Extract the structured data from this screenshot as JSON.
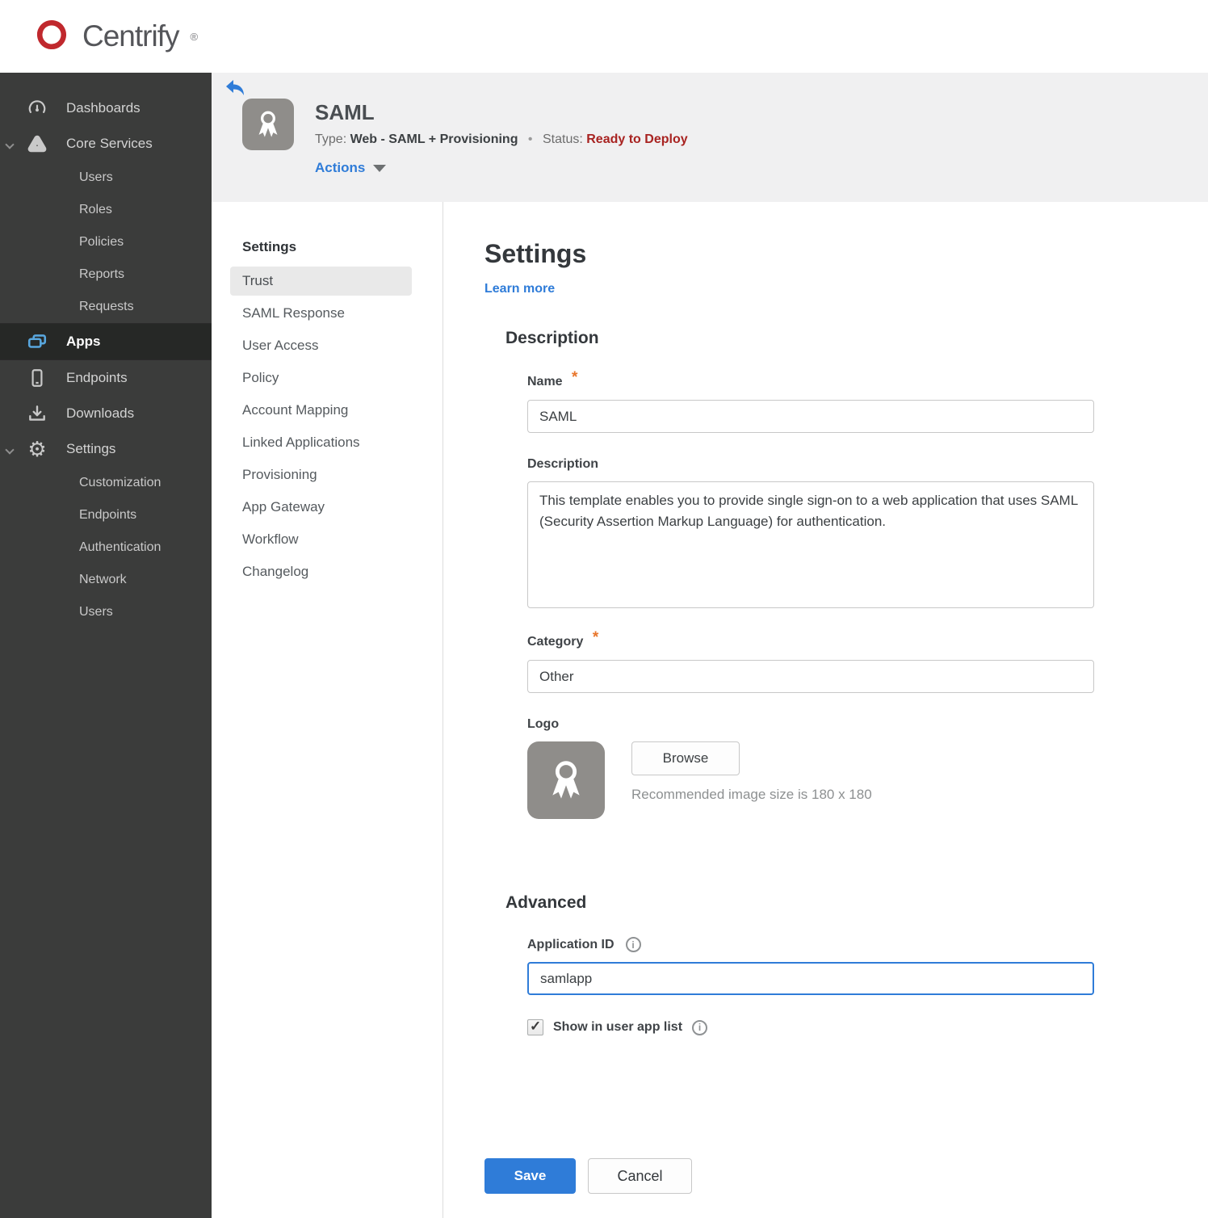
{
  "brand": {
    "name": "Centrify",
    "registered": "®",
    "logo_color": "#c0282d",
    "text_color": "#55565a"
  },
  "sidebar": {
    "dashboards": "Dashboards",
    "core_services": "Core Services",
    "core_children": [
      "Users",
      "Roles",
      "Policies",
      "Reports",
      "Requests"
    ],
    "apps": "Apps",
    "endpoints": "Endpoints",
    "downloads": "Downloads",
    "settings": "Settings",
    "settings_children": [
      "Customization",
      "Endpoints",
      "Authentication",
      "Network",
      "Users"
    ],
    "active_item": "Apps",
    "bg_color": "#3b3c3b",
    "active_icon_color": "#58a6dd"
  },
  "app_header": {
    "title": "SAML",
    "type_label": "Type:",
    "type_value": "Web - SAML + Provisioning",
    "separator": "•",
    "status_label": "Status:",
    "status_value": "Ready to Deploy",
    "status_color": "#a82321",
    "actions_label": "Actions"
  },
  "app_nav": {
    "header": "Settings",
    "items": [
      "Trust",
      "SAML Response",
      "User Access",
      "Policy",
      "Account Mapping",
      "Linked Applications",
      "Provisioning",
      "App Gateway",
      "Workflow",
      "Changelog"
    ],
    "selected": "Trust"
  },
  "main": {
    "title": "Settings",
    "learn_more": "Learn more",
    "description": {
      "heading": "Description",
      "name_label": "Name",
      "required_mark": "*",
      "name_value": "SAML",
      "description_label": "Description",
      "description_value": "This template enables you to provide single sign-on to a web application that uses SAML (Security Assertion Markup Language) for authentication.",
      "category_label": "Category",
      "category_value": "Other",
      "logo_label": "Logo",
      "browse_button": "Browse",
      "logo_hint": "Recommended image size is 180 x 180"
    },
    "advanced": {
      "heading": "Advanced",
      "app_id_label": "Application ID",
      "app_id_value": "samlapp",
      "show_in_list_label": "Show in user app list",
      "checked_attr": "checked"
    },
    "buttons": {
      "save": "Save",
      "cancel": "Cancel"
    }
  },
  "colors": {
    "accent_blue": "#2f7cd8",
    "status_red": "#a82321",
    "required_orange": "#e8762c",
    "brand_red": "#c0282d",
    "app_icon_gray": "#8f8d8a"
  },
  "icons": {
    "brand": "centrify-swirl-icon",
    "dashboards": "gauge-icon",
    "core_services": "nodes-triangle-icon",
    "apps": "stacked-windows-icon",
    "endpoints": "smartphone-icon",
    "downloads": "download-icon",
    "settings": "gear-icon",
    "back": "back-arrow-icon",
    "app_logo": "award-ribbon-icon",
    "info": "info-icon",
    "caret": "caret-down-icon"
  }
}
